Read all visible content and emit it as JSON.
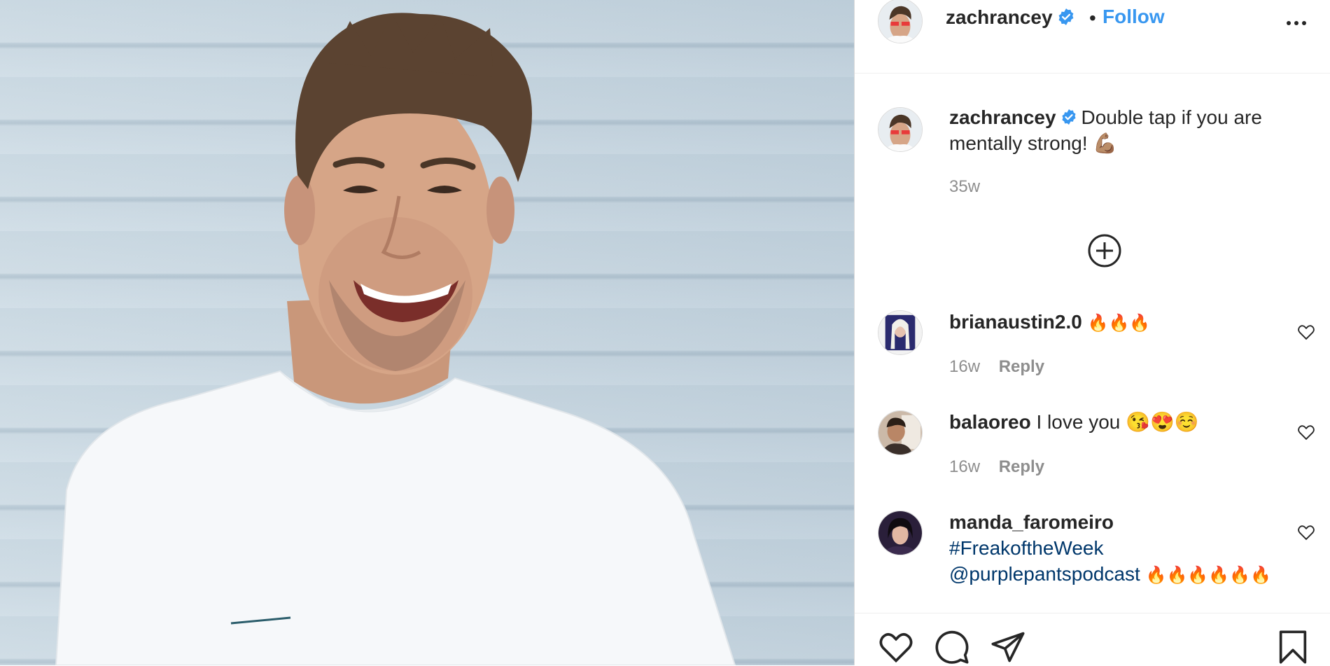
{
  "post": {
    "author": "zachrancey",
    "follow_label": "Follow",
    "separator": "•"
  },
  "caption": {
    "username": "zachrancey",
    "text": "Double tap if you are mentally strong! 💪🏽",
    "time": "35w"
  },
  "comments": [
    {
      "username": "brianaustin2.0",
      "text": "🔥🔥🔥",
      "time": "16w",
      "reply": "Reply"
    },
    {
      "username": "balaoreo",
      "text": "I love you 😘😍☺️",
      "time": "16w",
      "reply": "Reply"
    },
    {
      "username": "manda_faromeiro",
      "hashtag": "#FreakoftheWeek",
      "mention": "@purplepantspodcast",
      "text": "🔥🔥🔥🔥🔥🔥"
    }
  ],
  "icons": {
    "verified": "verified-badge-icon",
    "more": "more-options-icon",
    "load_more": "load-more-comments-icon",
    "like": "heart-icon",
    "comment": "comment-icon",
    "share": "share-icon",
    "save": "bookmark-icon"
  },
  "colors": {
    "link": "#3897f0",
    "hashtag": "#00376b",
    "muted": "#8e8e8e",
    "text": "#262626"
  }
}
